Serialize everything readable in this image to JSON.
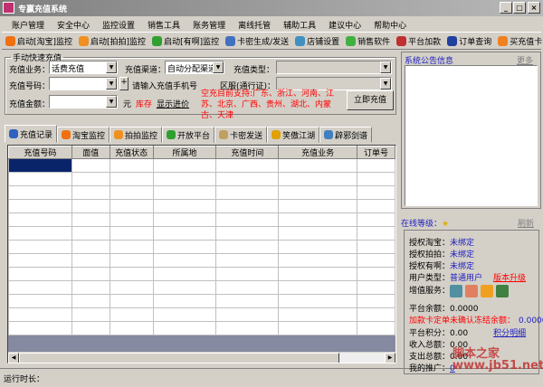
{
  "window": {
    "title": "专赢充值系统",
    "min": "_",
    "max": "□",
    "close": "×"
  },
  "menu": [
    "账户管理",
    "安全中心",
    "监控设置",
    "销售工具",
    "账务管理",
    "离线托管",
    "辅助工具",
    "建议中心",
    "帮助中心"
  ],
  "toolbar": [
    {
      "label": "启动[淘宝]监控",
      "icon": "taobao-icon",
      "color": "#f07010"
    },
    {
      "label": "启动[拍拍]监控",
      "icon": "paipai-icon",
      "color": "#f09020"
    },
    {
      "label": "启动[有啊]监控",
      "icon": "youa-icon",
      "color": "#30a030"
    },
    {
      "label": "卡密生成/发送",
      "icon": "card-icon",
      "color": "#4070c0"
    },
    {
      "label": "店铺设置",
      "icon": "shop-icon",
      "color": "#4090c0"
    },
    {
      "label": "销售软件",
      "icon": "recycle-icon",
      "color": "#40b040"
    },
    {
      "label": "平台加款",
      "icon": "trophy-icon",
      "color": "#c03030"
    },
    {
      "label": "订单查询",
      "icon": "chart-icon",
      "color": "#2040a0"
    },
    {
      "label": "买充值卡",
      "icon": "card-buy-icon",
      "color": "#f08020"
    }
  ],
  "form": {
    "legend": "手动快速充值",
    "business_label": "充值业务：",
    "business_value": "话费充值",
    "channel_label": "充值渠道：",
    "channel_value": "自动分配渠道",
    "type_label": "充值类型：",
    "number_label": "充值号码：",
    "plus": "+",
    "number_hint": "请输入充值手机号",
    "region_label": "区服(通行证)：",
    "amount_label": "充值金额：",
    "unit": "元",
    "stock": "库存",
    "show_price": "显示进价",
    "notice": "空充目前支持:广东、浙江、河南、江苏、北京、广西、贵州、湖北、内蒙古、天津",
    "submit": "立即充值"
  },
  "tabs": [
    {
      "label": "充值记录",
      "icon": "bar-chart-icon",
      "color": "#3060c0"
    },
    {
      "label": "淘宝监控",
      "icon": "taobao-icon",
      "color": "#f07010"
    },
    {
      "label": "拍拍监控",
      "icon": "paipai-icon",
      "color": "#f09020"
    },
    {
      "label": "开放平台",
      "icon": "youa-icon",
      "color": "#30a030"
    },
    {
      "label": "卡密发送",
      "icon": "cart-icon",
      "color": "#c0a060"
    },
    {
      "label": "笑傲江湖",
      "icon": "game-icon",
      "color": "#e0a000"
    },
    {
      "label": "辟邪剑谱",
      "icon": "book-icon",
      "color": "#4080c0"
    }
  ],
  "table": {
    "columns": [
      "充值号码",
      "面值",
      "充值状态",
      "所属地",
      "充值时间",
      "充值业务",
      "订单号"
    ],
    "rows": 13
  },
  "status": {
    "runtime_label": "运行时长："
  },
  "notice_panel": {
    "title": "系统公告信息",
    "more": "更多"
  },
  "online": {
    "title": "在线等级：",
    "refresh": "刷新",
    "taobao_label": "授权淘宝：",
    "taobao_value": "未绑定",
    "paipai_label": "授权拍拍：",
    "paipai_value": "未绑定",
    "youa_label": "授权有啊：",
    "youa_value": "未绑定",
    "user_type_label": "用户类型：",
    "user_type_value": "普通用户",
    "upgrade": "版本升级",
    "vas_label": "增值服务：",
    "balance_label": "平台余额：",
    "balance_value": "0.0000",
    "frozen_label": "加款卡定单未确认冻结余额：",
    "frozen_value": "0.0000",
    "points_label": "平台积分：",
    "points_value": "0.00",
    "points_detail": "积分明细",
    "income_label": "收入总额：",
    "income_value": "0.00",
    "expense_label": "支出总额：",
    "expense_value": "0.00",
    "promo_label": "我的推广：",
    "promo_value": "0"
  },
  "watermark": "脚本之家 www.jb51.net"
}
